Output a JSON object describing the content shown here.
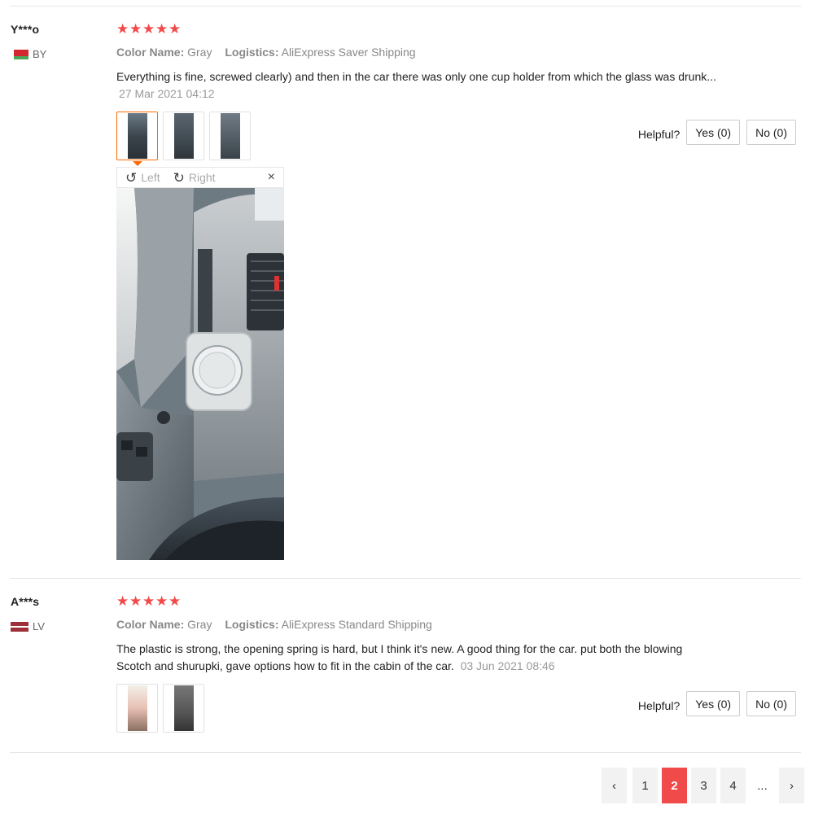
{
  "reviews": [
    {
      "user": "Y***o",
      "country": "BY",
      "rating": 5,
      "color_label": "Color Name:",
      "color_value": "Gray",
      "logistics_label": "Logistics:",
      "logistics_value": "AliExpress Saver Shipping",
      "text": "Everything is fine, screwed clearly) and then in the car there was only one cup holder from which the glass was drunk...",
      "date": "27 Mar 2021 04:12",
      "helpful_label": "Helpful?",
      "yes_label": "Yes (0)",
      "no_label": "No (0)"
    },
    {
      "user": "A***s",
      "country": "LV",
      "rating": 5,
      "color_label": "Color Name:",
      "color_value": "Gray",
      "logistics_label": "Logistics:",
      "logistics_value": "AliExpress Standard Shipping",
      "text_line1": "The plastic is strong, the opening spring is hard, but I think it's new. A good thing for the car. put both the blowing",
      "text_line2": "Scotch and shurupki, gave options how to fit in the cabin of the car.",
      "date": "03 Jun 2021 08:46",
      "helpful_label": "Helpful?",
      "yes_label": "Yes (0)",
      "no_label": "No (0)"
    }
  ],
  "viewer": {
    "left_label": "Left",
    "right_label": "Right",
    "close_symbol": "×",
    "rotate_left_icon": "↺",
    "rotate_right_icon": "↻"
  },
  "stars": "★",
  "pagination": {
    "prev": "‹",
    "pages": [
      "1",
      "2",
      "3",
      "4"
    ],
    "current": "2",
    "ellipsis": "...",
    "next": "›"
  },
  "colors": {
    "accent": "#f04a4a",
    "star": "#f24a4a",
    "active_thumb": "#ff6a00"
  }
}
